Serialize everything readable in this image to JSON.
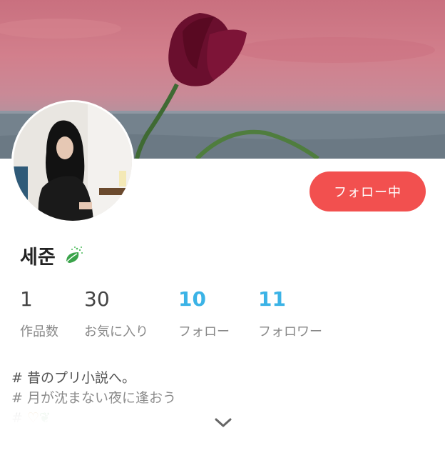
{
  "profile": {
    "name": "세준",
    "badge_icon": "leaf-icon",
    "follow_button_label": "フォロー中",
    "accent_color": "#f2504f"
  },
  "stats": [
    {
      "value": "1",
      "label": "作品数",
      "highlight": false
    },
    {
      "value": "30",
      "label": "お気に入り",
      "highlight": false
    },
    {
      "value": "10",
      "label": "フォロー",
      "highlight": true
    },
    {
      "value": "11",
      "label": "フォロワー",
      "highlight": true
    }
  ],
  "bio": {
    "line1": "# 昔のプリ小説へ。",
    "line2": "# 月が沈まない夜に逢おう",
    "line3": "#"
  },
  "expand_icon": "chevron-down-icon"
}
